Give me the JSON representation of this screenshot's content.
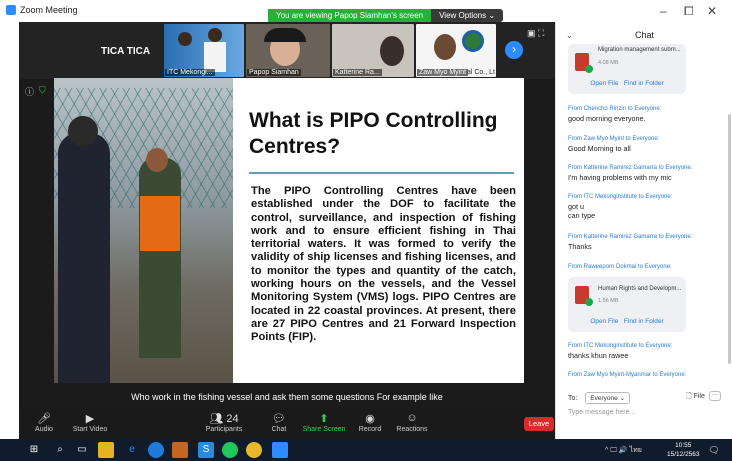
{
  "app": {
    "title": "Zoom Meeting"
  },
  "banner": {
    "viewing": "You are viewing Papop Siamhan's screen",
    "options": "View Options ⌄"
  },
  "window": {
    "minimize": "–",
    "maximize": "⧠",
    "close": "✕"
  },
  "participants_strip": {
    "name_tile": "TICA TICA",
    "thumbs": [
      {
        "label": "ITC Mekongi..."
      },
      {
        "label": "Papop Siamhan"
      },
      {
        "label": "Katterine Ra..."
      },
      {
        "label": "Zaw Myo Myint"
      }
    ],
    "extra_label": "al Co., Lt"
  },
  "slide": {
    "title": "What is PIPO Controlling Centres?",
    "body": "The PIPO Controlling Centres have been established under the DOF to facilitate the control, surveillance, and inspection of fishing work and to ensure efficient fishing in Thai territorial waters. It was formed to verify the validity of ship licenses and fishing licenses, and to monitor the types and quantity of the catch, working hours on the vessels, and the Vessel Monitoring System (VMS) logs. PIPO Centres are located in 22 coastal provinces. At present, there are 27 PIPO Centres and 21 Forward Inspection Points (FIP)."
  },
  "caption": "Who work in the fishing vessel and ask them some questions For example like",
  "toolbar": {
    "audio": "Audio",
    "video": "Start Video",
    "participants": "Participants",
    "participants_count": "24",
    "chat": "Chat",
    "share": "Share Screen",
    "record": "Record",
    "reactions": "Reactions",
    "leave": "Leave"
  },
  "chat": {
    "title": "Chat",
    "files": [
      {
        "name": "Migration management subm...",
        "size": "4.08 MB",
        "open": "Open File",
        "folder": "Find in Folder"
      },
      {
        "name": "Human Rights and Developm...",
        "size": "1.56 MB",
        "open": "Open File",
        "folder": "Find in Folder"
      }
    ],
    "messages": [
      {
        "from": "From Chencho Rinzin to Everyone:",
        "text": "good morning everyone."
      },
      {
        "from": "From Zaw Myo Myint to Everyone:",
        "text": "Good Morning to all"
      },
      {
        "from": "From Katterine Ramirez Gamarra to Everyone:",
        "text": "I'm having problems with my mic"
      },
      {
        "from": "From ITC Mekonginstitute to Everyone:",
        "text": "got u",
        "text2": "can type"
      },
      {
        "from": "From Katterine Ramirez Gamarra to Everyone:",
        "text": "Thanks"
      },
      {
        "from": "From Raweeporn Dokmai to Everyone:"
      },
      {
        "from": "From ITC Mekonginstitute to Everyone:",
        "text": "thanks khun rawee"
      },
      {
        "from": "From Zaw Myo Myint-Myanmar to Everyone:"
      }
    ],
    "to_label": "To:",
    "to_value": "Everyone ⌄",
    "file_button": "File",
    "more": "···",
    "input_placeholder": "Type message here..."
  },
  "taskbar": {
    "time": "10:55",
    "date": "15/12/2563",
    "lang": "ไทย"
  }
}
